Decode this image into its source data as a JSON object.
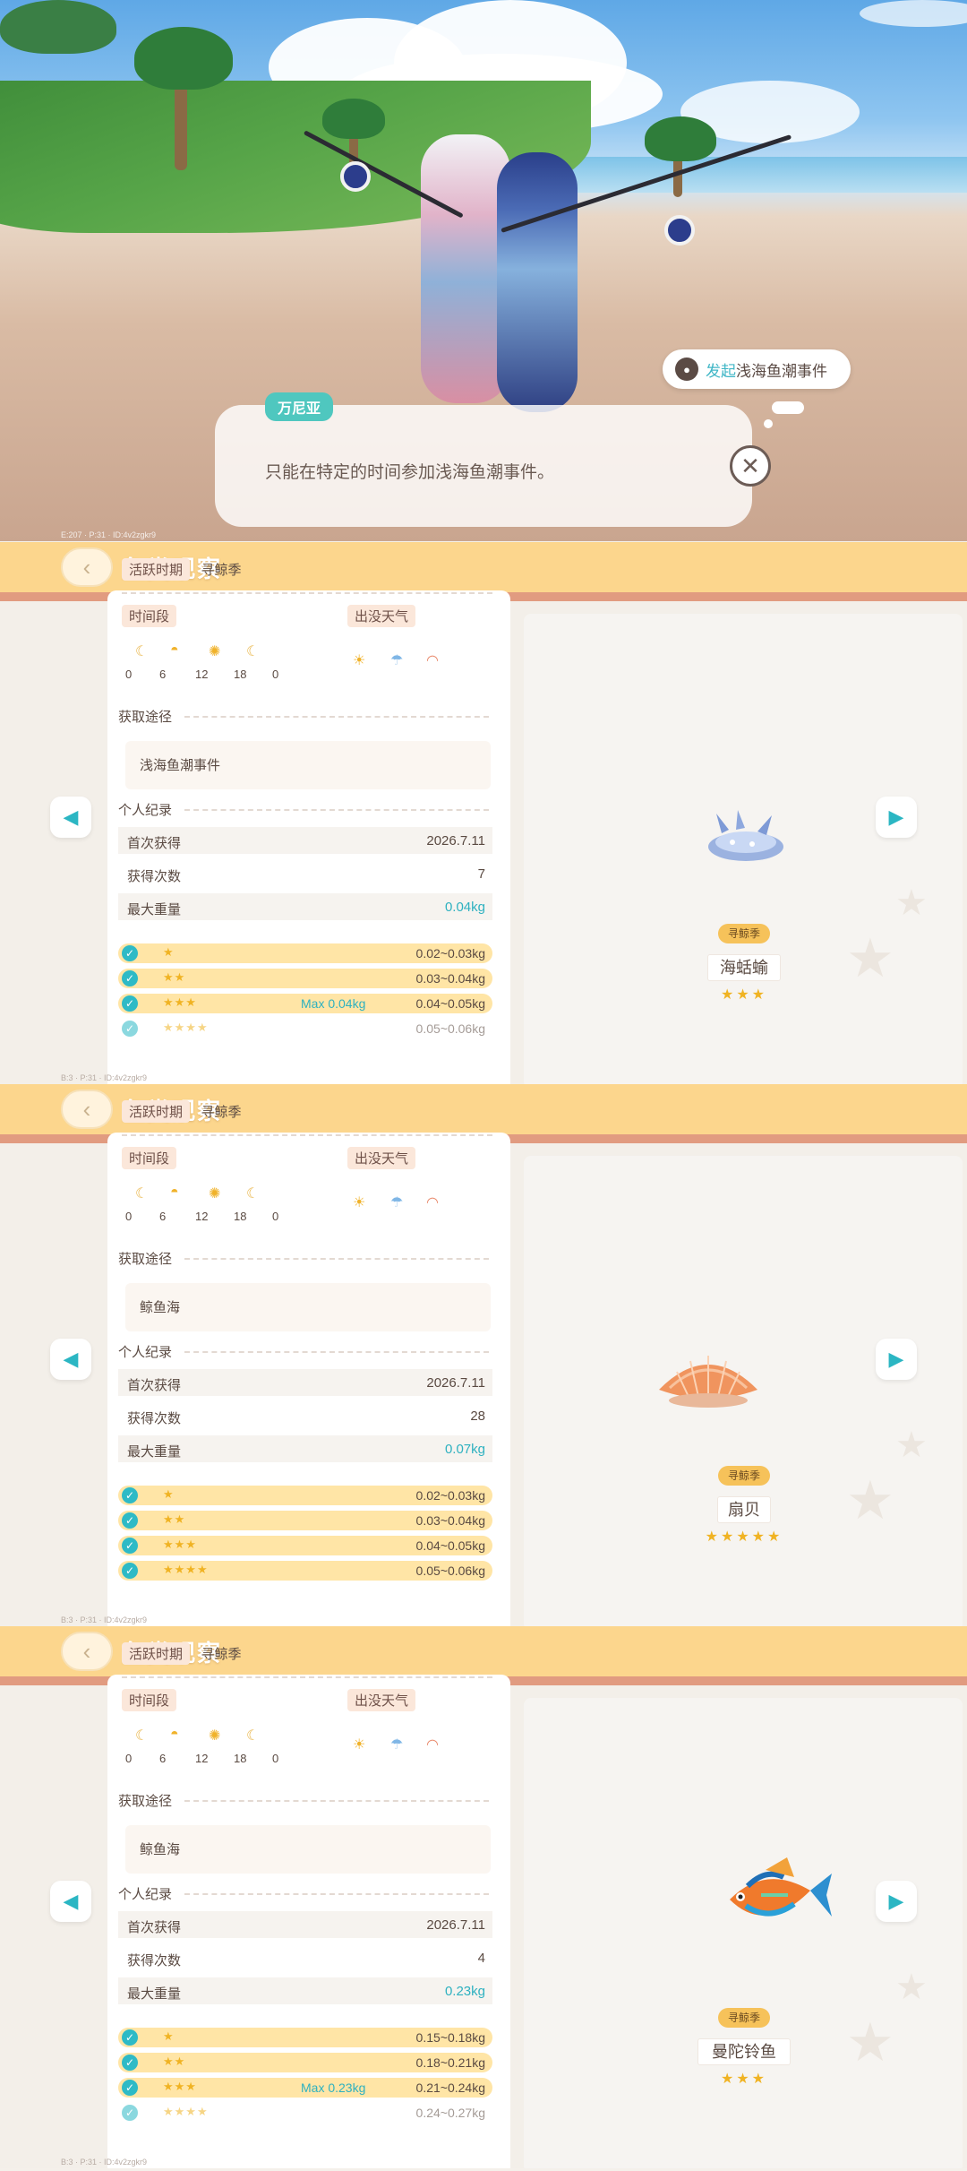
{
  "scene": {
    "bubble_action": "发起",
    "bubble_event": "浅海鱼潮事件",
    "npc_name": "万尼亚",
    "npc_text": "只能在特定的时间参加浅海鱼潮事件。",
    "close_glyph": "✕",
    "uid": "E:207 · P:31 · ID:4v2zgkr9"
  },
  "common": {
    "panel_title": "鱼类观察",
    "active_label": "活跃时期",
    "active_value": "寻鲸季",
    "time_label": "时间段",
    "weather_label": "出没天气",
    "time_ticks": [
      "0",
      "6",
      "12",
      "18",
      "0"
    ],
    "time_icons": [
      "moon-icon",
      "sunrise-icon",
      "sun-icon",
      "moon-icon"
    ],
    "weather_icons": [
      "sunny-icon",
      "rain-icon",
      "rainbow-icon"
    ],
    "source_label": "获取途径",
    "record_label": "个人纪录",
    "first_label": "首次获得",
    "count_label": "获得次数",
    "weight_label": "最大重量",
    "season_badge": "寻鲸季",
    "back_glyph": "‹",
    "left_glyph": "◀",
    "right_glyph": "▶",
    "check_glyph": "✓"
  },
  "panels": [
    {
      "source": "浅海鱼潮事件",
      "first_date": "2026.7.11",
      "count": "7",
      "max_weight": "0.04kg",
      "grades": [
        {
          "stars": "★",
          "max": "",
          "range": "0.02~0.03kg"
        },
        {
          "stars": "★★",
          "max": "",
          "range": "0.03~0.04kg"
        },
        {
          "stars": "★★★",
          "max": "Max 0.04kg",
          "range": "0.04~0.05kg"
        },
        {
          "stars": "★★★★",
          "max": "",
          "range": "0.05~0.06kg"
        }
      ],
      "fish_name": "海蛞蝓",
      "fish_stars": "★★★",
      "fish_icon": "sea-slug-icon",
      "uid": "B:3 · P:31 · ID:4v2zgkr9"
    },
    {
      "source": "鲸鱼海",
      "first_date": "2026.7.11",
      "count": "28",
      "max_weight": "0.07kg",
      "grades": [
        {
          "stars": "★",
          "max": "",
          "range": "0.02~0.03kg"
        },
        {
          "stars": "★★",
          "max": "",
          "range": "0.03~0.04kg"
        },
        {
          "stars": "★★★",
          "max": "",
          "range": "0.04~0.05kg"
        },
        {
          "stars": "★★★★",
          "max": "",
          "range": "0.05~0.06kg"
        }
      ],
      "fish_name": "扇贝",
      "fish_stars": "★★★★★",
      "fish_icon": "scallop-icon",
      "uid": "B:3 · P:31 · ID:4v2zgkr9"
    },
    {
      "source": "鲸鱼海",
      "first_date": "2026.7.11",
      "count": "4",
      "max_weight": "0.23kg",
      "grades": [
        {
          "stars": "★",
          "max": "",
          "range": "0.15~0.18kg"
        },
        {
          "stars": "★★",
          "max": "",
          "range": "0.18~0.21kg"
        },
        {
          "stars": "★★★",
          "max": "Max 0.23kg",
          "range": "0.21~0.24kg"
        },
        {
          "stars": "★★★★",
          "max": "",
          "range": "0.24~0.27kg"
        }
      ],
      "fish_name": "曼陀铃鱼",
      "fish_stars": "★★★",
      "fish_icon": "mandarinfish-icon",
      "uid": "B:3 · P:31 · ID:4v2zgkr9"
    }
  ],
  "colors": {
    "accent_teal": "#2eb1c0",
    "topbar": "#fcd68d",
    "grade_bar": "#ffe5a6",
    "star": "#f0b323"
  }
}
